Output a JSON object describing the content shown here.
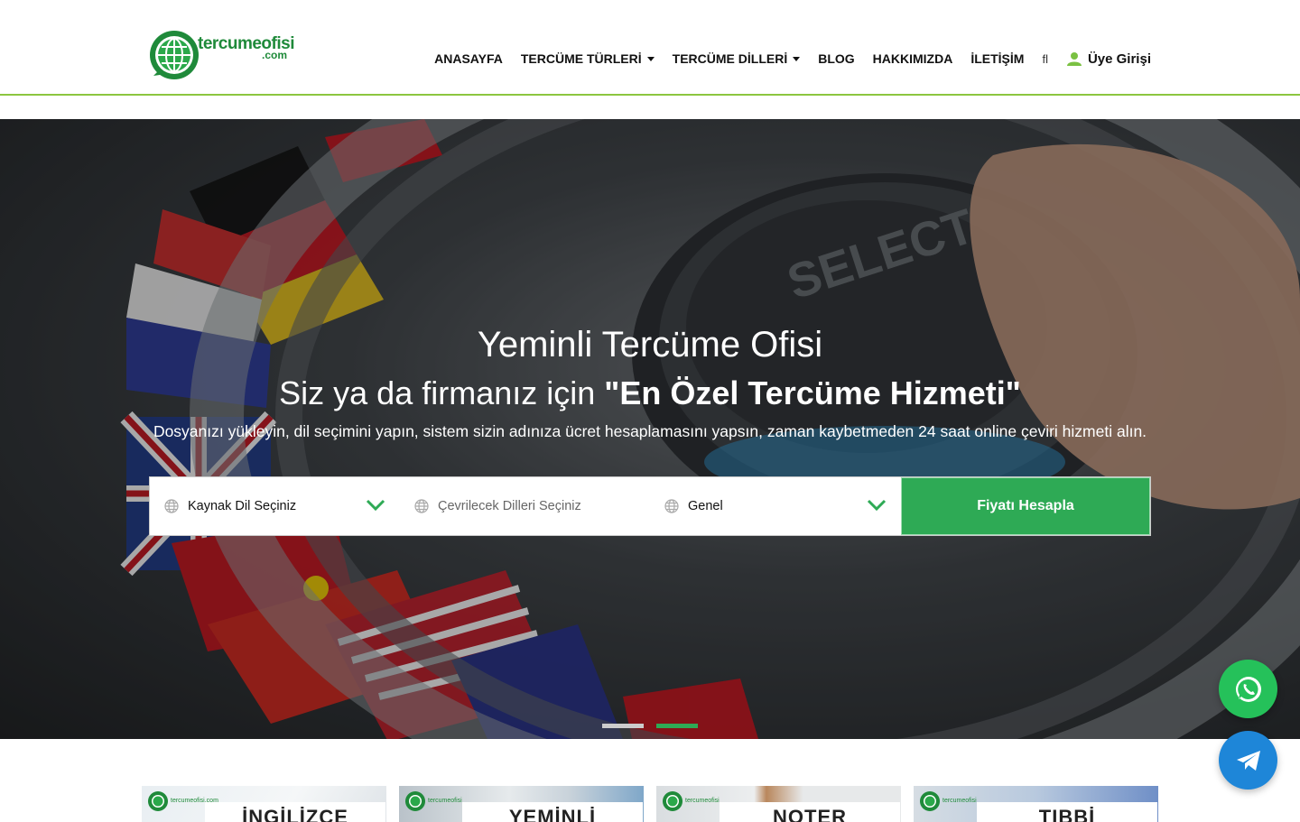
{
  "brand": {
    "name": "tercumeofisi",
    "tld": ".com",
    "accent_color": "#8cc63f",
    "primary_green": "#2eaa55"
  },
  "nav": {
    "items": [
      {
        "label": "ANASAYFA",
        "dropdown": false
      },
      {
        "label": "TERCÜME TÜRLERİ",
        "dropdown": true
      },
      {
        "label": "TERCÜME DİLLERİ",
        "dropdown": true
      },
      {
        "label": "BLOG",
        "dropdown": false
      },
      {
        "label": "HAKKIMIZDA",
        "dropdown": false
      },
      {
        "label": "İLETİŞİM",
        "dropdown": false
      }
    ],
    "extra_glyph": "fl",
    "login_label": "Üye Girişi"
  },
  "hero": {
    "title": "Yeminli Tercüme Ofisi",
    "subtitle_prefix": "Siz ya da firmanız için ",
    "subtitle_bold": "\"En Özel Tercüme Hizmeti\"",
    "description": "Dosyanızı yükleyin, dil seçimini yapın, sistem sizin adınıza ücret hesaplamasını yapsın, zaman kaybetmeden 24 saat online çeviri hizmeti alın.",
    "form": {
      "source_language": "Kaynak Dil Seçiniz",
      "target_languages_placeholder": "Çevrilecek Dilleri Seçiniz",
      "category": "Genel",
      "submit_label": "Fiyatı Hesapla"
    },
    "slides": [
      {
        "active": false
      },
      {
        "active": true
      }
    ]
  },
  "floating": {
    "whatsapp_icon": "whatsapp-icon",
    "telegram_icon": "telegram-icon"
  },
  "cards": [
    {
      "brand": "tercumeofisi.com",
      "title": "İNGİLİZCE"
    },
    {
      "brand": "tercumeofisi",
      "title": "YEMİNLİ"
    },
    {
      "brand": "tercumeofisi",
      "title": "NOTER"
    },
    {
      "brand": "tercumeofisi",
      "title": "TIBBİ"
    }
  ]
}
